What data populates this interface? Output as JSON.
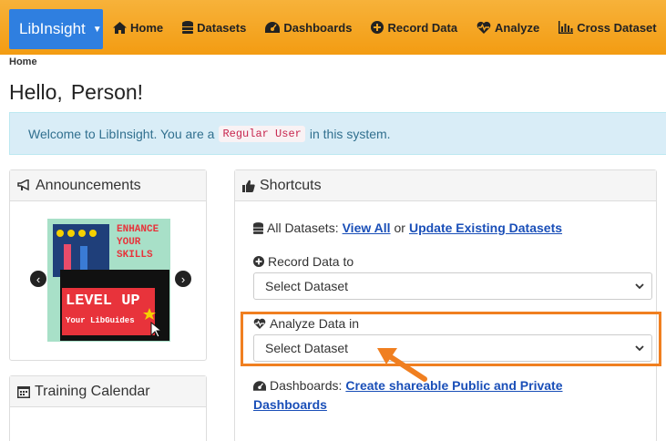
{
  "navbar": {
    "brand": "LibInsight",
    "items": [
      {
        "label": "Home",
        "icon": "home-icon"
      },
      {
        "label": "Datasets",
        "icon": "database-icon"
      },
      {
        "label": "Dashboards",
        "icon": "dashboard-icon"
      },
      {
        "label": "Record Data",
        "icon": "plus-circle-icon"
      },
      {
        "label": "Analyze",
        "icon": "heartbeat-icon"
      },
      {
        "label": "Cross Dataset",
        "icon": "bar-chart-icon"
      }
    ]
  },
  "breadcrumb": "Home",
  "greeting": {
    "hello": "Hello,",
    "name": "Person!"
  },
  "welcome": {
    "before": "Welcome to LibInsight. You are a",
    "role": "Regular User",
    "after": "in this system."
  },
  "announcements": {
    "title": "Announcements",
    "slide_text": {
      "line1": "ENHANCE",
      "line2": "YOUR",
      "line3": "SKILLS",
      "line4": "LEVEL UP",
      "line5": "Your LibGuides"
    }
  },
  "training": {
    "title": "Training Calendar"
  },
  "shortcuts": {
    "title": "Shortcuts",
    "all_datasets_label": "All Datasets:",
    "view_all": "View All",
    "or": "or",
    "update_existing": "Update Existing Datasets",
    "record_label": "Record Data to",
    "record_select": "Select Dataset",
    "analyze_label": "Analyze Data in",
    "analyze_select": "Select Dataset",
    "dashboards_label": "Dashboards:",
    "dashboards_link_1": "Create shareable Public and Private",
    "dashboards_link_2": "Dashboards"
  },
  "colors": {
    "navbar": "#f5a623",
    "brand": "#2f7fe0",
    "highlight": "#f07f20",
    "alert_bg": "#d9edf7"
  }
}
